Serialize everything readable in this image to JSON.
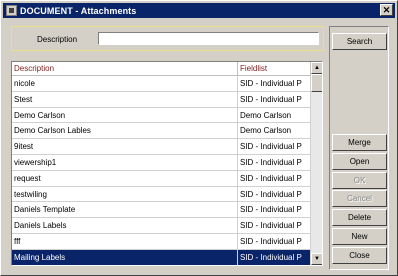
{
  "window": {
    "title": "DOCUMENT - Attachments",
    "close_symbol": "✕"
  },
  "search": {
    "label": "Description",
    "value": "",
    "button": "Search"
  },
  "grid": {
    "columns": [
      "Description",
      "Fieldlist"
    ],
    "rows": [
      [
        "nicole",
        "SID - Individual P"
      ],
      [
        "Stest",
        "SID - Individual P"
      ],
      [
        "Demo Carlson",
        "Demo Carlson"
      ],
      [
        "Demo Carlson Lables",
        "Demo Carlson"
      ],
      [
        "9itest",
        "SID - Individual P"
      ],
      [
        "viewership1",
        "SID - Individual P"
      ],
      [
        "request",
        "SID - Individual P"
      ],
      [
        "testwiling",
        "SID - Individual P"
      ],
      [
        "Daniels Template",
        "SID - Individual P"
      ],
      [
        "Daniels Labels",
        "SID - Individual P"
      ],
      [
        "fff",
        "SID - Individual P"
      ],
      [
        "Mailing Labels",
        "SID - Individual P"
      ]
    ],
    "selected_index": 11
  },
  "buttons": {
    "merge": "Merge",
    "open": "Open",
    "ok": "OK",
    "cancel": "Cancel",
    "delete": "Delete",
    "new": "New",
    "close": "Close"
  },
  "icons": {
    "scroll_up": "▲",
    "scroll_down": "▼",
    "app": "document-app-icon"
  }
}
